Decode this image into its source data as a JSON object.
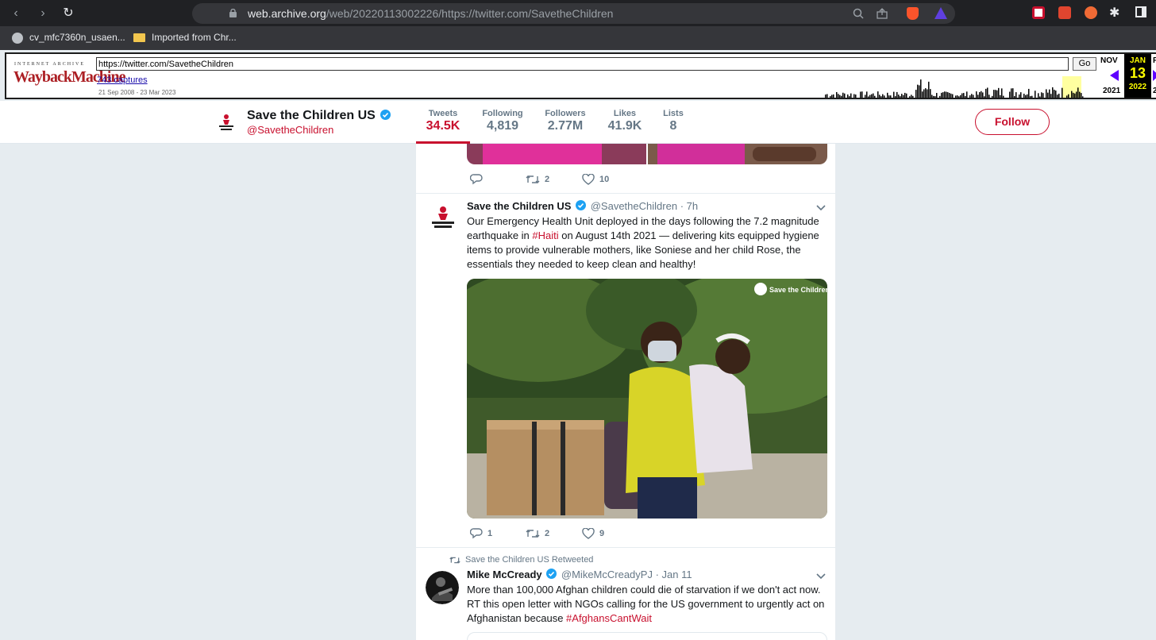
{
  "browser": {
    "url_domain": "web.archive.org",
    "url_path": "/web/20220113002226/https://twitter.com/SavetheChildren",
    "bookmarks": [
      {
        "label": "cv_mfc7360n_usaen..."
      },
      {
        "label": "Imported from Chr..."
      }
    ]
  },
  "wayback": {
    "logo_top": "INTERNET ARCHIVE",
    "logo": "WaybackMachine",
    "url_value": "https://twitter.com/SavetheChildren",
    "go_label": "Go",
    "captures": "743 captures",
    "date_range": "21 Sep 2008 - 23 Mar 2023",
    "prev_month": "NOV",
    "prev_year": "2021",
    "cur_month": "JAN",
    "cur_day": "13",
    "cur_year": "2022",
    "next_month": "F",
    "next_year": "2",
    "colors": {
      "current": "#ffff00",
      "arrow": "#5f00ff",
      "logo": "#ac1f24"
    }
  },
  "profile": {
    "name": "Save the Children US",
    "handle": "@SavetheChildren",
    "stats": [
      {
        "label": "Tweets",
        "value": "34.5K"
      },
      {
        "label": "Following",
        "value": "4,819"
      },
      {
        "label": "Followers",
        "value": "2.77M"
      },
      {
        "label": "Likes",
        "value": "41.9K"
      },
      {
        "label": "Lists",
        "value": "8"
      }
    ],
    "follow_label": "Follow",
    "accent": "#c8102e"
  },
  "timeline": {
    "prev_actions": {
      "reply": "",
      "retweets": "2",
      "likes": "10"
    },
    "tweet1": {
      "name": "Save the Children US",
      "handle": "@SavetheChildren",
      "time": "· 7h",
      "text_a": "Our Emergency Health Unit deployed in the days following the 7.2 magnitude earthquake in ",
      "hashtag": "#Haiti",
      "text_b": " on August 14th 2021 — delivering kits equipped hygiene items to provide vulnerable mothers, like Soniese and her child Rose, the essentials they needed to keep clean and healthy!",
      "watermark": "Save the Children",
      "replies": "1",
      "retweets": "2",
      "likes": "9"
    },
    "retweet_notice": "Save the Children US Retweeted",
    "tweet2": {
      "name": "Mike McCready",
      "handle": "@MikeMcCreadyPJ",
      "time": "· Jan 11",
      "text_a": "More than 100,000 Afghan children could die of starvation if we don't act now. RT this open letter with NGOs calling for the US government to urgently act on Afghanistan because ",
      "hashtag": "#AfghansCantWait"
    }
  }
}
